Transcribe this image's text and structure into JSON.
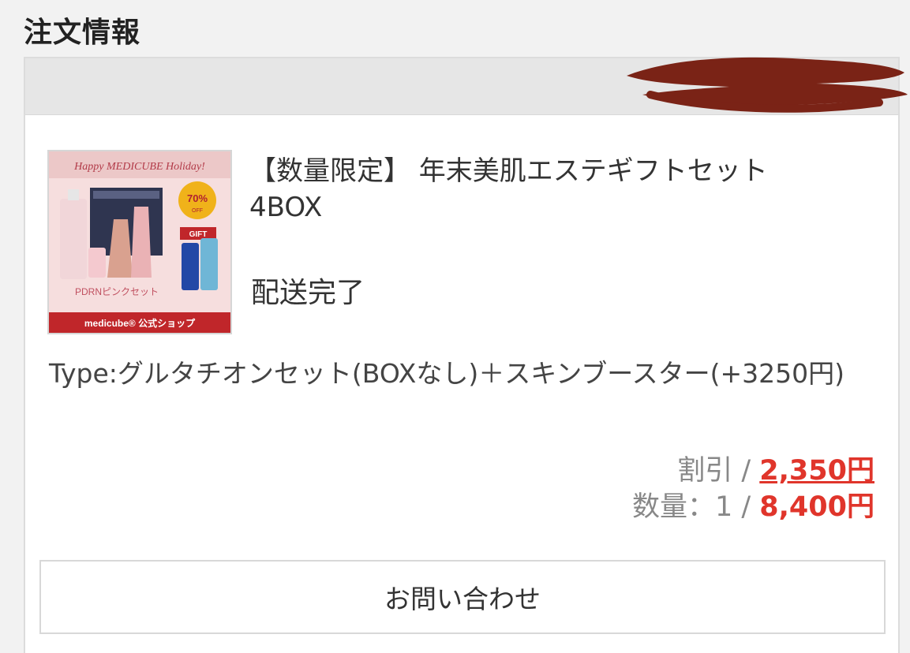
{
  "section": {
    "title": "注文情報"
  },
  "product": {
    "name": "【数量限定】 年末美肌エステギフトセット 4BOX",
    "status": "配送完了",
    "image": {
      "banner_text": "Happy MEDICUBE Holiday!",
      "badge_percent": "70%",
      "badge_off": "OFF",
      "gift_label": "GIFT",
      "set_label": "PDRNピンクセット",
      "shop_label": "medicube® 公式ショップ",
      "colors": {
        "bg": "#f6dede",
        "shop_bar": "#c0262a",
        "badge": "#f0b21a"
      }
    }
  },
  "variant": {
    "text": "Type:グルタチオンセット(BOXなし)＋スキンブースター(+3250円)"
  },
  "pricing": {
    "discount_label": "割引 / ",
    "discount_value": "2,350円",
    "quantity_label": "数量：1 / ",
    "total_value": "8,400円",
    "accent_color": "#e0352b"
  },
  "actions": {
    "contact_label": "お問い合わせ"
  }
}
